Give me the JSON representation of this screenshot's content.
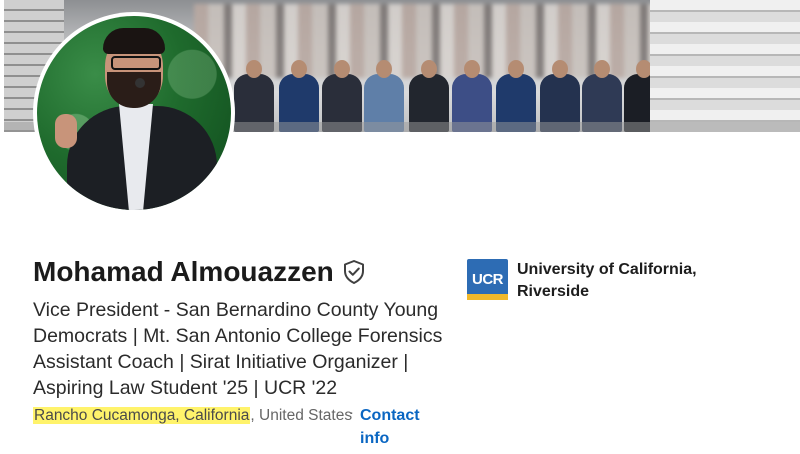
{
  "profile": {
    "name": "Mohamad Almouazzen",
    "headline": "Vice President - San Bernardino County Young Democrats | Mt. San Antonio College Forensics Assistant Coach | Sirat Initiative Organizer | Aspiring Law Student '25 | UCR '22",
    "location_highlighted": "Rancho Cucamonga, California",
    "location_rest": "United States",
    "location_separator": ",",
    "contact_label": "Contact info",
    "contact_separator": "·"
  },
  "school": {
    "logo_text": "UCR",
    "name": "University of California, Riverside"
  },
  "icons": {
    "verified": "verified-shield-icon"
  },
  "colors": {
    "link": "#0a66c2",
    "highlight": "#fff36b",
    "school_logo": "#2d6cb4",
    "school_logo_accent": "#f1b92b"
  }
}
